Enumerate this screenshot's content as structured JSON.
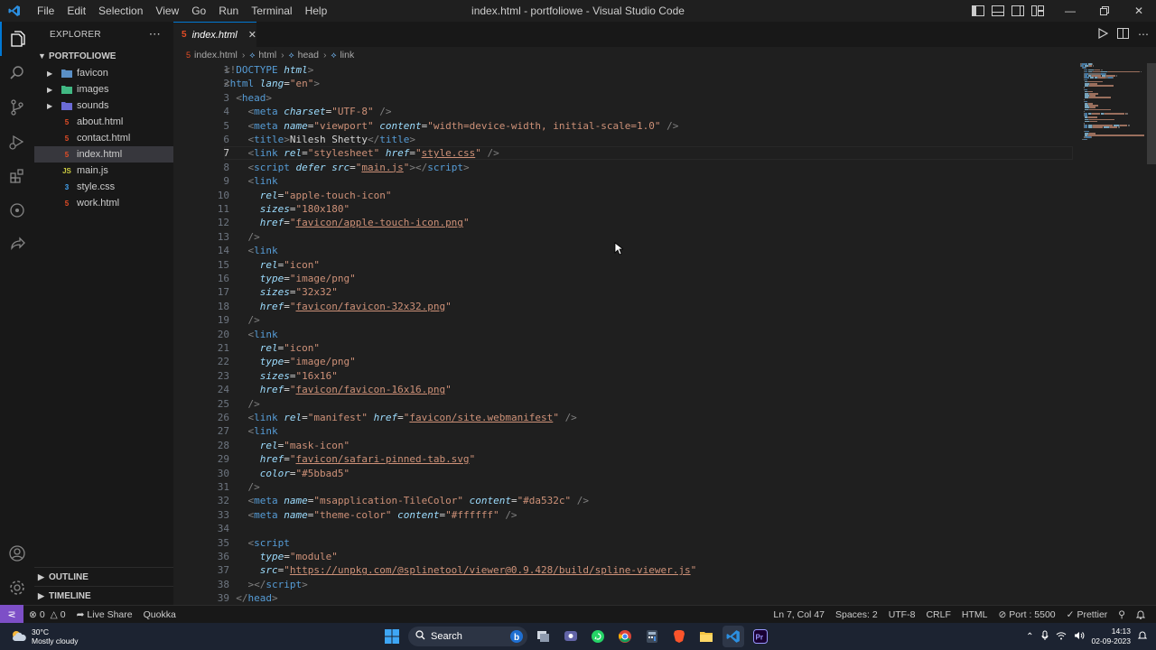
{
  "titlebar": {
    "menu": [
      "File",
      "Edit",
      "Selection",
      "View",
      "Go",
      "Run",
      "Terminal",
      "Help"
    ],
    "window_title": "index.html - portfoliowe - Visual Studio Code"
  },
  "sidebar": {
    "header": "EXPLORER",
    "project": "PORTFOLIOWE",
    "tree": [
      {
        "label": "favicon",
        "type": "folder",
        "icon": "folder-icon",
        "color": "#5a8fc5"
      },
      {
        "label": "images",
        "type": "folder",
        "icon": "image-folder-icon",
        "color": "#41b883"
      },
      {
        "label": "sounds",
        "type": "folder",
        "icon": "sound-folder-icon",
        "color": "#6b6bd6"
      },
      {
        "label": "about.html",
        "type": "file",
        "icon": "html-file-icon",
        "color": "#e44d26"
      },
      {
        "label": "contact.html",
        "type": "file",
        "icon": "html-file-icon",
        "color": "#e44d26"
      },
      {
        "label": "index.html",
        "type": "file",
        "icon": "html-file-icon",
        "color": "#e44d26",
        "selected": true
      },
      {
        "label": "main.js",
        "type": "file",
        "icon": "js-file-icon",
        "color": "#cbcb41"
      },
      {
        "label": "style.css",
        "type": "file",
        "icon": "css-file-icon",
        "color": "#42a5f5"
      },
      {
        "label": "work.html",
        "type": "file",
        "icon": "html-file-icon",
        "color": "#e44d26"
      }
    ],
    "outline": "OUTLINE",
    "timeline": "TIMELINE"
  },
  "editor": {
    "tab_label": "index.html",
    "breadcrumb": [
      "index.html",
      "html",
      "head",
      "link"
    ],
    "current_line": 7,
    "lines": [
      [
        [
          "p",
          "<!"
        ],
        [
          "tag",
          "DOCTYPE"
        ],
        [
          "t",
          " "
        ],
        [
          "attr",
          "html"
        ],
        [
          "p",
          ">"
        ]
      ],
      [
        [
          "p",
          "<"
        ],
        [
          "tag",
          "html"
        ],
        [
          "t",
          " "
        ],
        [
          "attr",
          "lang"
        ],
        [
          "t",
          "="
        ],
        [
          "str",
          "\"en\""
        ],
        [
          "p",
          ">"
        ]
      ],
      [
        [
          "t",
          "  "
        ],
        [
          "p",
          "<"
        ],
        [
          "tag",
          "head"
        ],
        [
          "p",
          ">"
        ]
      ],
      [
        [
          "t",
          "    "
        ],
        [
          "p",
          "<"
        ],
        [
          "tag",
          "meta"
        ],
        [
          "t",
          " "
        ],
        [
          "attr",
          "charset"
        ],
        [
          "t",
          "="
        ],
        [
          "str",
          "\"UTF-8\""
        ],
        [
          "t",
          " "
        ],
        [
          "p",
          "/>"
        ]
      ],
      [
        [
          "t",
          "    "
        ],
        [
          "p",
          "<"
        ],
        [
          "tag",
          "meta"
        ],
        [
          "t",
          " "
        ],
        [
          "attr",
          "name"
        ],
        [
          "t",
          "="
        ],
        [
          "str",
          "\"viewport\""
        ],
        [
          "t",
          " "
        ],
        [
          "attr",
          "content"
        ],
        [
          "t",
          "="
        ],
        [
          "str",
          "\"width=device-width, initial-scale=1.0\""
        ],
        [
          "t",
          " "
        ],
        [
          "p",
          "/>"
        ]
      ],
      [
        [
          "t",
          "    "
        ],
        [
          "p",
          "<"
        ],
        [
          "tag",
          "title"
        ],
        [
          "p",
          ">"
        ],
        [
          "t",
          "Nilesh Shetty"
        ],
        [
          "p",
          "</"
        ],
        [
          "tag",
          "title"
        ],
        [
          "p",
          ">"
        ]
      ],
      [
        [
          "t",
          "    "
        ],
        [
          "p",
          "<"
        ],
        [
          "tag",
          "link"
        ],
        [
          "t",
          " "
        ],
        [
          "attr",
          "rel"
        ],
        [
          "t",
          "="
        ],
        [
          "str",
          "\"stylesheet\""
        ],
        [
          "t",
          " "
        ],
        [
          "attr",
          "href"
        ],
        [
          "t",
          "="
        ],
        [
          "str",
          "\""
        ],
        [
          "link",
          "style.css"
        ],
        [
          "str",
          "\""
        ],
        [
          "t",
          " "
        ],
        [
          "p",
          "/>"
        ]
      ],
      [
        [
          "t",
          "    "
        ],
        [
          "p",
          "<"
        ],
        [
          "tag",
          "script"
        ],
        [
          "t",
          " "
        ],
        [
          "attr",
          "defer"
        ],
        [
          "t",
          " "
        ],
        [
          "attr",
          "src"
        ],
        [
          "t",
          "="
        ],
        [
          "str",
          "\""
        ],
        [
          "link",
          "main.js"
        ],
        [
          "str",
          "\""
        ],
        [
          "p",
          "></"
        ],
        [
          "tag",
          "script"
        ],
        [
          "p",
          ">"
        ]
      ],
      [
        [
          "t",
          "    "
        ],
        [
          "p",
          "<"
        ],
        [
          "tag",
          "link"
        ]
      ],
      [
        [
          "t",
          "      "
        ],
        [
          "attr",
          "rel"
        ],
        [
          "t",
          "="
        ],
        [
          "str",
          "\"apple-touch-icon\""
        ]
      ],
      [
        [
          "t",
          "      "
        ],
        [
          "attr",
          "sizes"
        ],
        [
          "t",
          "="
        ],
        [
          "str",
          "\"180x180\""
        ]
      ],
      [
        [
          "t",
          "      "
        ],
        [
          "attr",
          "href"
        ],
        [
          "t",
          "="
        ],
        [
          "str",
          "\""
        ],
        [
          "link",
          "favicon/apple-touch-icon.png"
        ],
        [
          "str",
          "\""
        ]
      ],
      [
        [
          "t",
          "    "
        ],
        [
          "p",
          "/>"
        ]
      ],
      [
        [
          "t",
          "    "
        ],
        [
          "p",
          "<"
        ],
        [
          "tag",
          "link"
        ]
      ],
      [
        [
          "t",
          "      "
        ],
        [
          "attr",
          "rel"
        ],
        [
          "t",
          "="
        ],
        [
          "str",
          "\"icon\""
        ]
      ],
      [
        [
          "t",
          "      "
        ],
        [
          "attr",
          "type"
        ],
        [
          "t",
          "="
        ],
        [
          "str",
          "\"image/png\""
        ]
      ],
      [
        [
          "t",
          "      "
        ],
        [
          "attr",
          "sizes"
        ],
        [
          "t",
          "="
        ],
        [
          "str",
          "\"32x32\""
        ]
      ],
      [
        [
          "t",
          "      "
        ],
        [
          "attr",
          "href"
        ],
        [
          "t",
          "="
        ],
        [
          "str",
          "\""
        ],
        [
          "link",
          "favicon/favicon-32x32.png"
        ],
        [
          "str",
          "\""
        ]
      ],
      [
        [
          "t",
          "    "
        ],
        [
          "p",
          "/>"
        ]
      ],
      [
        [
          "t",
          "    "
        ],
        [
          "p",
          "<"
        ],
        [
          "tag",
          "link"
        ]
      ],
      [
        [
          "t",
          "      "
        ],
        [
          "attr",
          "rel"
        ],
        [
          "t",
          "="
        ],
        [
          "str",
          "\"icon\""
        ]
      ],
      [
        [
          "t",
          "      "
        ],
        [
          "attr",
          "type"
        ],
        [
          "t",
          "="
        ],
        [
          "str",
          "\"image/png\""
        ]
      ],
      [
        [
          "t",
          "      "
        ],
        [
          "attr",
          "sizes"
        ],
        [
          "t",
          "="
        ],
        [
          "str",
          "\"16x16\""
        ]
      ],
      [
        [
          "t",
          "      "
        ],
        [
          "attr",
          "href"
        ],
        [
          "t",
          "="
        ],
        [
          "str",
          "\""
        ],
        [
          "link",
          "favicon/favicon-16x16.png"
        ],
        [
          "str",
          "\""
        ]
      ],
      [
        [
          "t",
          "    "
        ],
        [
          "p",
          "/>"
        ]
      ],
      [
        [
          "t",
          "    "
        ],
        [
          "p",
          "<"
        ],
        [
          "tag",
          "link"
        ],
        [
          "t",
          " "
        ],
        [
          "attr",
          "rel"
        ],
        [
          "t",
          "="
        ],
        [
          "str",
          "\"manifest\""
        ],
        [
          "t",
          " "
        ],
        [
          "attr",
          "href"
        ],
        [
          "t",
          "="
        ],
        [
          "str",
          "\""
        ],
        [
          "link",
          "favicon/site.webmanifest"
        ],
        [
          "str",
          "\""
        ],
        [
          "t",
          " "
        ],
        [
          "p",
          "/>"
        ]
      ],
      [
        [
          "t",
          "    "
        ],
        [
          "p",
          "<"
        ],
        [
          "tag",
          "link"
        ]
      ],
      [
        [
          "t",
          "      "
        ],
        [
          "attr",
          "rel"
        ],
        [
          "t",
          "="
        ],
        [
          "str",
          "\"mask-icon\""
        ]
      ],
      [
        [
          "t",
          "      "
        ],
        [
          "attr",
          "href"
        ],
        [
          "t",
          "="
        ],
        [
          "str",
          "\""
        ],
        [
          "link",
          "favicon/safari-pinned-tab.svg"
        ],
        [
          "str",
          "\""
        ]
      ],
      [
        [
          "t",
          "      "
        ],
        [
          "attr",
          "color"
        ],
        [
          "t",
          "="
        ],
        [
          "str",
          "\"#5bbad5\""
        ]
      ],
      [
        [
          "t",
          "    "
        ],
        [
          "p",
          "/>"
        ]
      ],
      [
        [
          "t",
          "    "
        ],
        [
          "p",
          "<"
        ],
        [
          "tag",
          "meta"
        ],
        [
          "t",
          " "
        ],
        [
          "attr",
          "name"
        ],
        [
          "t",
          "="
        ],
        [
          "str",
          "\"msapplication-TileColor\""
        ],
        [
          "t",
          " "
        ],
        [
          "attr",
          "content"
        ],
        [
          "t",
          "="
        ],
        [
          "str",
          "\"#da532c\""
        ],
        [
          "t",
          " "
        ],
        [
          "p",
          "/>"
        ]
      ],
      [
        [
          "t",
          "    "
        ],
        [
          "p",
          "<"
        ],
        [
          "tag",
          "meta"
        ],
        [
          "t",
          " "
        ],
        [
          "attr",
          "name"
        ],
        [
          "t",
          "="
        ],
        [
          "str",
          "\"theme-color\""
        ],
        [
          "t",
          " "
        ],
        [
          "attr",
          "content"
        ],
        [
          "t",
          "="
        ],
        [
          "str",
          "\"#ffffff\""
        ],
        [
          "t",
          " "
        ],
        [
          "p",
          "/>"
        ]
      ],
      [],
      [
        [
          "t",
          "    "
        ],
        [
          "p",
          "<"
        ],
        [
          "tag",
          "script"
        ]
      ],
      [
        [
          "t",
          "      "
        ],
        [
          "attr",
          "type"
        ],
        [
          "t",
          "="
        ],
        [
          "str",
          "\"module\""
        ]
      ],
      [
        [
          "t",
          "      "
        ],
        [
          "attr",
          "src"
        ],
        [
          "t",
          "="
        ],
        [
          "str",
          "\""
        ],
        [
          "link",
          "https://unpkg.com/@splinetool/viewer@0.9.428/build/spline-viewer.js"
        ],
        [
          "str",
          "\""
        ]
      ],
      [
        [
          "t",
          "    "
        ],
        [
          "p",
          "></"
        ],
        [
          "tag",
          "script"
        ],
        [
          "p",
          ">"
        ]
      ],
      [
        [
          "t",
          "  "
        ],
        [
          "p",
          "</"
        ],
        [
          "tag",
          "head"
        ],
        [
          "p",
          ">"
        ]
      ]
    ]
  },
  "statusbar": {
    "errors": "0",
    "warnings": "0",
    "live_share": "Live Share",
    "quokka": "Quokka",
    "position": "Ln 7, Col 47",
    "spaces": "Spaces: 2",
    "encoding": "UTF-8",
    "eol": "CRLF",
    "language": "HTML",
    "port": "Port : 5500",
    "prettier": "Prettier"
  },
  "taskbar": {
    "temperature": "30°C",
    "weather": "Mostly cloudy",
    "search_placeholder": "Search",
    "time": "14:13",
    "date": "02-09-2023"
  },
  "colors": {
    "accent": "#0078d4",
    "editor_bg": "#1f1f1f",
    "sidebar_bg": "#181818",
    "remote": "#7d4fc7"
  }
}
